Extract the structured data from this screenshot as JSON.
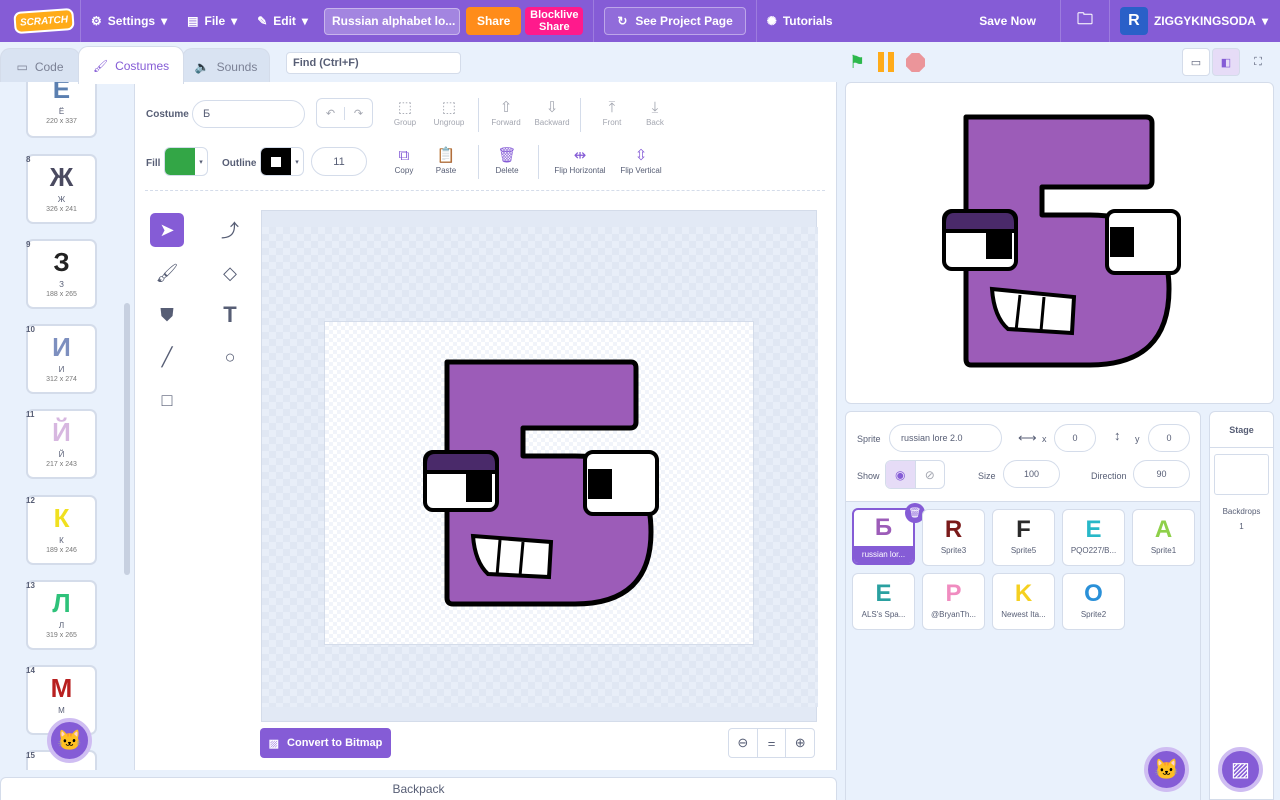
{
  "menubar": {
    "logo": "SCRATCH",
    "settings": "Settings",
    "file": "File",
    "edit": "Edit",
    "project_title": "Russian alphabet lo...",
    "share": "Share",
    "blocklive_line1": "Blocklive",
    "blocklive_line2": "Share",
    "see_project": "See Project Page",
    "tutorials": "Tutorials",
    "save_now": "Save Now",
    "username": "ZIGGYKINGSODA"
  },
  "tabs": {
    "code": "Code",
    "costumes": "Costumes",
    "sounds": "Sounds"
  },
  "find_placeholder": "Find (Ctrl+F)",
  "costumes": [
    {
      "num": "",
      "glyph": "Ё",
      "name": "Ё",
      "size": "220 x 337",
      "color": "#5b7fb0"
    },
    {
      "num": "8",
      "glyph": "Ж",
      "name": "Ж",
      "size": "326 x 241",
      "color": "#4a4a60"
    },
    {
      "num": "9",
      "glyph": "З",
      "name": "З",
      "size": "188 x 265",
      "color": "#222222"
    },
    {
      "num": "10",
      "glyph": "И",
      "name": "И",
      "size": "312 x 274",
      "color": "#7d8fbf"
    },
    {
      "num": "11",
      "glyph": "Й",
      "name": "Й",
      "size": "217 x 243",
      "color": "#d7b7e0"
    },
    {
      "num": "12",
      "glyph": "К",
      "name": "К",
      "size": "189 x 246",
      "color": "#f0e020"
    },
    {
      "num": "13",
      "glyph": "Л",
      "name": "Л",
      "size": "319 x 265",
      "color": "#2ec27a"
    },
    {
      "num": "14",
      "glyph": "М",
      "name": "М",
      "size": "",
      "color": "#b82020"
    },
    {
      "num": "15",
      "glyph": "",
      "name": "",
      "size": "",
      "color": "#999999"
    }
  ],
  "editor": {
    "costume_label": "Costume",
    "costume_name": "Б",
    "fill_label": "Fill",
    "fill_color": "#33a646",
    "outline_label": "Outline",
    "outline_color": "#000000",
    "outline_width": "11",
    "group": "Group",
    "ungroup": "Ungroup",
    "forward": "Forward",
    "backward": "Backward",
    "front": "Front",
    "back": "Back",
    "copy": "Copy",
    "paste": "Paste",
    "delete": "Delete",
    "flip_h": "Flip Horizontal",
    "flip_v": "Flip Vertical",
    "convert": "Convert to Bitmap",
    "letter_color": "#9c5cb8"
  },
  "backpack": "Backpack",
  "sprite_info": {
    "sprite_label": "Sprite",
    "sprite_name": "russian lore 2.0",
    "x_label": "x",
    "x_value": "0",
    "y_label": "y",
    "y_value": "0",
    "show_label": "Show",
    "size_label": "Size",
    "size_value": "100",
    "direction_label": "Direction",
    "direction_value": "90"
  },
  "sprites": [
    {
      "name": "russian lor...",
      "glyph": "Б",
      "color": "#9c5cb8"
    },
    {
      "name": "Sprite3",
      "glyph": "R",
      "color": "#7a1a1a"
    },
    {
      "name": "Sprite5",
      "glyph": "F",
      "color": "#2a2a2a"
    },
    {
      "name": "PQO227/B...",
      "glyph": "E",
      "color": "#28b8c8"
    },
    {
      "name": "Sprite1",
      "glyph": "A",
      "color": "#8ed04a"
    },
    {
      "name": "ALS's Spa...",
      "glyph": "E",
      "color": "#2aa0a0"
    },
    {
      "name": "@BryanTh...",
      "glyph": "P",
      "color": "#f08cc0"
    },
    {
      "name": "Newest Ita...",
      "glyph": "K",
      "color": "#f5d020"
    },
    {
      "name": "Sprite2",
      "glyph": "O",
      "color": "#2a90d8"
    }
  ],
  "stage_panel": {
    "title": "Stage",
    "backdrops_label": "Backdrops",
    "backdrops_count": "1"
  }
}
